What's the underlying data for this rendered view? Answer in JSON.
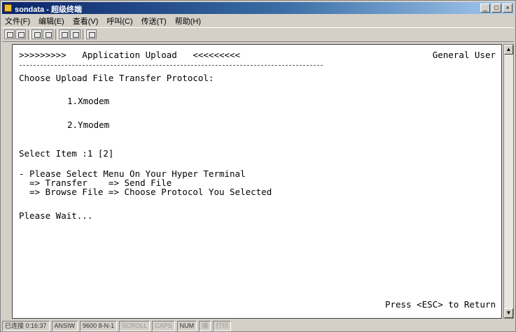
{
  "window": {
    "title": "sondata - 超级终端"
  },
  "menubar": {
    "items": [
      "文件(F)",
      "编辑(E)",
      "查看(V)",
      "呼叫(C)",
      "传送(T)",
      "帮助(H)"
    ]
  },
  "terminal": {
    "header_left": ">>>>>>>>>   Application Upload   <<<<<<<<<",
    "header_right": "General User",
    "prompt": "Choose Upload File Transfer Protocol:",
    "options": [
      "1.Xmodem",
      "2.Ymodem"
    ],
    "select_item": "Select Item :1 [2]",
    "instructions": [
      "- Please Select Menu On Your Hyper Terminal",
      "  => Transfer    => Send File",
      "  => Browse File => Choose Protocol You Selected"
    ],
    "wait": "Please Wait...",
    "footer": "Press <ESC> to Return"
  },
  "statusbar": {
    "time": "已连接 0:16:37",
    "emulation": "ANSIW",
    "port": "9600 8-N-1",
    "scroll": "SCROLL",
    "caps": "CAPS",
    "num": "NUM",
    "capture": "捕",
    "echo": "打印"
  }
}
